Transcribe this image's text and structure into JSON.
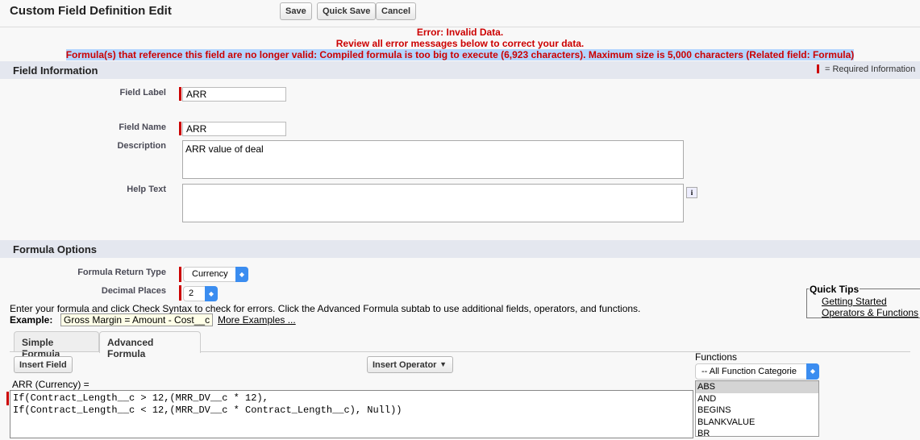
{
  "header": {
    "title": "Custom Field Definition Edit",
    "save": "Save",
    "quick_save": "Quick Save",
    "cancel": "Cancel"
  },
  "errors": {
    "line1": "Error: Invalid Data.",
    "line2": "Review all error messages below to correct your data.",
    "line3": "Formula(s) that reference this field are no longer valid: Compiled formula is too big to execute (6,923 characters). Maximum size is 5,000 characters (Related field: Formula)"
  },
  "field_info": {
    "title": "Field Information",
    "required_legend": "= Required Information",
    "field_label": {
      "label": "Field Label",
      "value": "ARR"
    },
    "field_name": {
      "label": "Field Name",
      "value": "ARR"
    },
    "description": {
      "label": "Description",
      "value": "ARR value of deal"
    },
    "help_text": {
      "label": "Help Text",
      "value": "",
      "info_icon": "i"
    }
  },
  "formula_options": {
    "title": "Formula Options",
    "return_type": {
      "label": "Formula Return Type",
      "value": "Currency"
    },
    "decimal_places": {
      "label": "Decimal Places",
      "value": "2"
    },
    "instructions": "Enter your formula and click Check Syntax to check for errors. Click the Advanced Formula subtab to use additional fields, operators, and functions.",
    "example_label": "Example:",
    "example_value": "Gross Margin = Amount - Cost__c",
    "more_examples": "More Examples ...",
    "quick_tips": {
      "title": "Quick Tips",
      "links": [
        "Getting Started",
        "Operators & Functions"
      ]
    },
    "tabs": [
      "Simple Formula",
      "Advanced Formula"
    ],
    "insert_field": "Insert Field",
    "insert_operator": "Insert Operator",
    "formula_label": "ARR (Currency) =",
    "formula": "If(Contract_Length__c > 12,(MRR_DV__c * 12),\nIf(Contract_Length__c < 12,(MRR_DV__c * Contract_Length__c), Null))",
    "functions": {
      "label": "Functions",
      "category": "-- All Function Categorie",
      "items": [
        "ABS",
        "AND",
        "BEGINS",
        "BLANKVALUE",
        "BR"
      ]
    }
  }
}
